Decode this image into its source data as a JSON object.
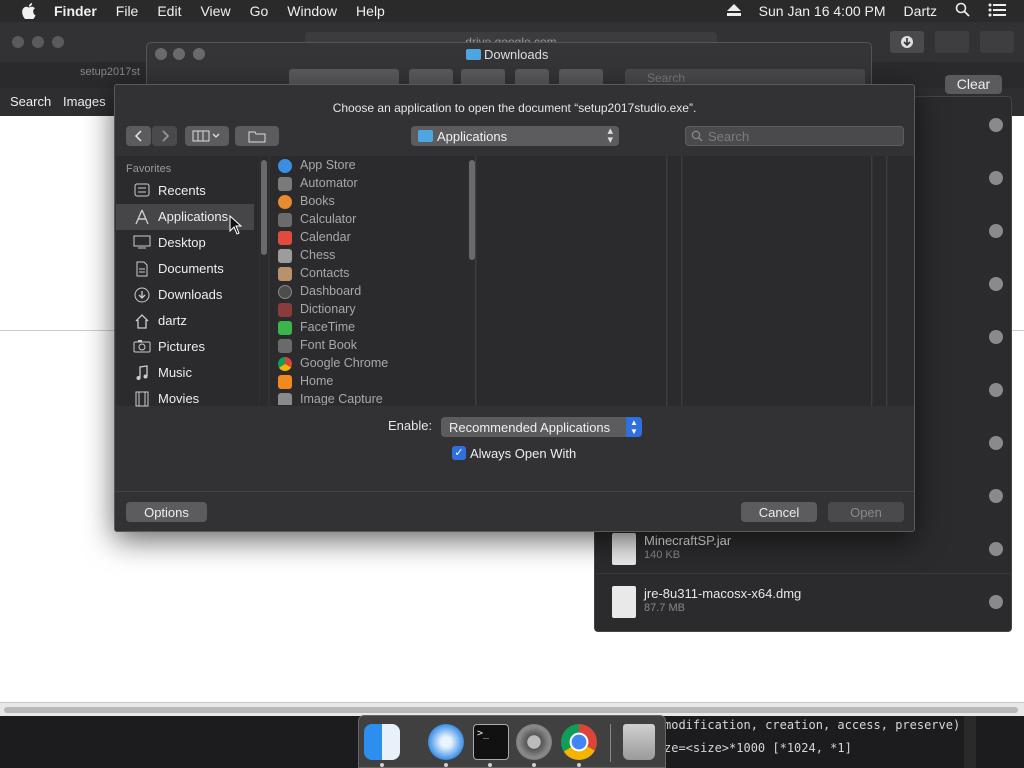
{
  "menubar": {
    "app": "Finder",
    "items": [
      "File",
      "Edit",
      "View",
      "Go",
      "Window",
      "Help"
    ],
    "clock": "Sun Jan 16  4:00 PM",
    "user": "Dartz"
  },
  "browser": {
    "url": "drive.google.com",
    "tab_title": "setup2017st",
    "nav_search": "Search",
    "nav_images": "Images"
  },
  "downloads": {
    "clear_label": "Clear",
    "items": [
      {
        "name": "MinecraftSP.jar",
        "size": "140 KB"
      },
      {
        "name": "jre-8u311-macosx-x64.dmg",
        "size": "87.7 MB"
      }
    ]
  },
  "finder_window": {
    "title": "Downloads",
    "search_placeholder": "Search"
  },
  "dialog": {
    "prompt": "Choose an application to open the document “setup2017studio.exe”.",
    "location": "Applications",
    "search_placeholder": "Search",
    "sidebar_header": "Favorites",
    "sidebar_items": [
      {
        "label": "Recents",
        "icon": "recents-icon"
      },
      {
        "label": "Applications",
        "icon": "applications-icon",
        "selected": true
      },
      {
        "label": "Desktop",
        "icon": "desktop-icon"
      },
      {
        "label": "Documents",
        "icon": "documents-icon"
      },
      {
        "label": "Downloads",
        "icon": "downloads-icon"
      },
      {
        "label": "dartz",
        "icon": "home-icon"
      },
      {
        "label": "Pictures",
        "icon": "pictures-icon"
      },
      {
        "label": "Music",
        "icon": "music-icon"
      },
      {
        "label": "Movies",
        "icon": "movies-icon"
      }
    ],
    "apps": [
      {
        "label": "App Store",
        "color": "#3a8ee6"
      },
      {
        "label": "Automator",
        "color": "#7a7a7a"
      },
      {
        "label": "Books",
        "color": "#e88a2e"
      },
      {
        "label": "Calculator",
        "color": "#6b6b6b"
      },
      {
        "label": "Calendar",
        "color": "#e04a3f"
      },
      {
        "label": "Chess",
        "color": "#9c9c9c"
      },
      {
        "label": "Contacts",
        "color": "#b8926a"
      },
      {
        "label": "Dashboard",
        "color": "#4d4d4d"
      },
      {
        "label": "Dictionary",
        "color": "#8a3b3b"
      },
      {
        "label": "FaceTime",
        "color": "#3bb54a"
      },
      {
        "label": "Font Book",
        "color": "#6a6a6a"
      },
      {
        "label": "Google Chrome",
        "color": "#e0a000"
      },
      {
        "label": "Home",
        "color": "#f08a1e"
      },
      {
        "label": "Image Capture",
        "color": "#8a8a8a"
      }
    ],
    "enable_label": "Enable:",
    "enable_value": "Recommended Applications",
    "always_open_label": "Always Open With",
    "always_open_checked": true,
    "options_label": "Options",
    "cancel_label": "Cancel",
    "open_label": "Open"
  },
  "terminal": {
    "line1": "modification, creation, access, preserve)",
    "line2": "ze=<size>*1000 [*1024, *1]"
  },
  "dock": {
    "apps": [
      "finder-icon",
      "safari-icon",
      "terminal-icon",
      "system-preferences-icon",
      "chrome-icon",
      "trash-icon"
    ]
  },
  "colors": {
    "accent": "#2f6fdf",
    "dialog_bg": "#323234",
    "sidebar_selected": "#464648"
  }
}
